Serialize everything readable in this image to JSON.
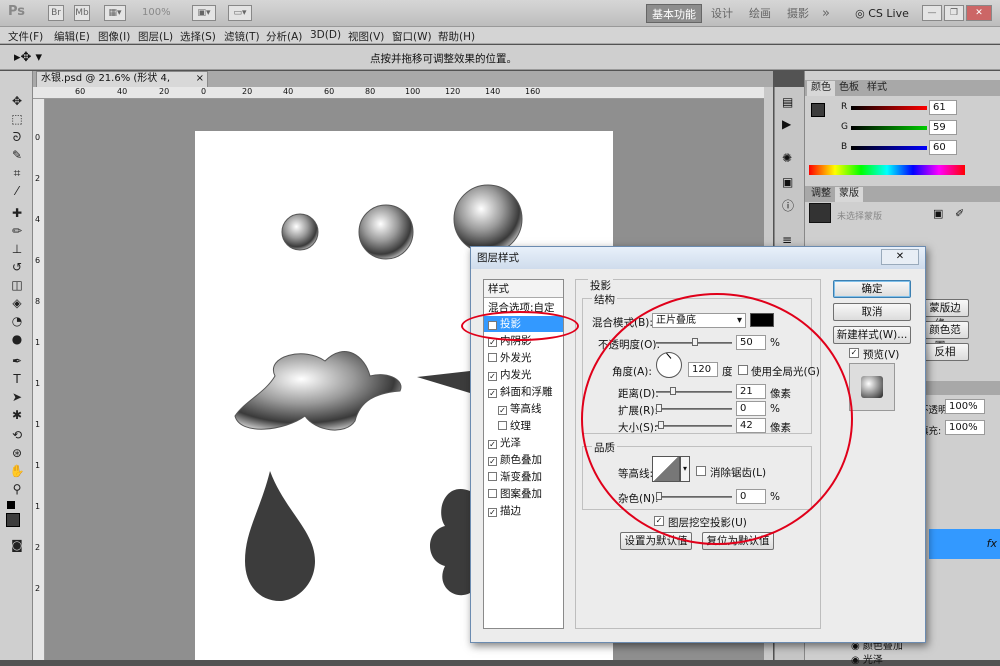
{
  "app": {
    "logo": "Ps",
    "zoom": "100%",
    "workspaces": [
      "基本功能",
      "设计",
      "绘画",
      "摄影"
    ],
    "more": "»",
    "cs_live": "CS Live"
  },
  "menu": [
    "文件(F)",
    "编辑(E)",
    "图像(I)",
    "图层(L)",
    "选择(S)",
    "滤镜(T)",
    "分析(A)",
    "3D(D)",
    "视图(V)",
    "窗口(W)",
    "帮助(H)"
  ],
  "options_bar": {
    "hint": "点按并拖移可调整效果的位置。"
  },
  "document": {
    "tab_label": "水银.psd @ 21.6% (形状 4, RGB/8) *",
    "close": "×"
  },
  "ruler_ticks": [
    "60",
    "40",
    "20",
    "0",
    "20",
    "40",
    "60",
    "80",
    "100",
    "120",
    "140",
    "160"
  ],
  "ruler_v_ticks": [
    "0",
    "2",
    "4",
    "6",
    "8",
    "1",
    "1",
    "1",
    "1",
    "1",
    "2",
    "2"
  ],
  "color_panel": {
    "tabs": [
      "颜色",
      "色板",
      "样式"
    ],
    "channels": [
      {
        "label": "R",
        "value": "61"
      },
      {
        "label": "G",
        "value": "59"
      },
      {
        "label": "B",
        "value": "60"
      }
    ]
  },
  "adjust_panel": {
    "tabs": [
      "调整",
      "蒙版"
    ],
    "mask_text": "未选择蒙版"
  },
  "right_misc": {
    "edge_btn": "蒙版边缘...",
    "range_btn": "颜色范围...",
    "invert_btn": "反相",
    "opacity_label": "不透明度:",
    "opacity": "100%",
    "fill_label": "填充:",
    "fill": "100%",
    "fx": "fx",
    "layer_effects": [
      "颜色叠加",
      "光泽"
    ]
  },
  "dialog": {
    "title": "图层样式",
    "close": "✕",
    "styles_header": "样式",
    "blend_options": "混合选项:自定",
    "styles": [
      {
        "label": "投影",
        "checked": true,
        "selected": true
      },
      {
        "label": "内阴影",
        "checked": true
      },
      {
        "label": "外发光",
        "checked": false
      },
      {
        "label": "内发光",
        "checked": true
      },
      {
        "label": "斜面和浮雕",
        "checked": true
      },
      {
        "label": "等高线",
        "checked": true,
        "indent": true
      },
      {
        "label": "纹理",
        "checked": false,
        "indent": true
      },
      {
        "label": "光泽",
        "checked": true
      },
      {
        "label": "颜色叠加",
        "checked": true
      },
      {
        "label": "渐变叠加",
        "checked": false
      },
      {
        "label": "图案叠加",
        "checked": false
      },
      {
        "label": "描边",
        "checked": true
      }
    ],
    "section_title": "投影",
    "structure_title": "结构",
    "blend_mode_label": "混合模式(B):",
    "blend_mode": "正片叠底",
    "shadow_color": "#000000",
    "opacity_label": "不透明度(O):",
    "opacity": "50",
    "angle_label": "角度(A):",
    "angle": "120",
    "angle_unit": "度",
    "global_light": "使用全局光(G)",
    "distance_label": "距离(D):",
    "distance": "21",
    "spread_label": "扩展(R):",
    "spread": "0",
    "size_label": "大小(S):",
    "size": "42",
    "unit_px": "像素",
    "unit_pct": "%",
    "quality_title": "品质",
    "contour_label": "等高线:",
    "antialias": "消除锯齿(L)",
    "noise_label": "杂色(N):",
    "noise": "0",
    "knockout": "图层挖空投影(U)",
    "make_default": "设置为默认值",
    "reset_default": "复位为默认值",
    "ok": "确定",
    "cancel": "取消",
    "new_style": "新建样式(W)...",
    "preview": "预览(V)"
  },
  "colors": {
    "accent": "#3399ff",
    "annotation": "#e0001a",
    "shape": "#3c3c3c"
  }
}
